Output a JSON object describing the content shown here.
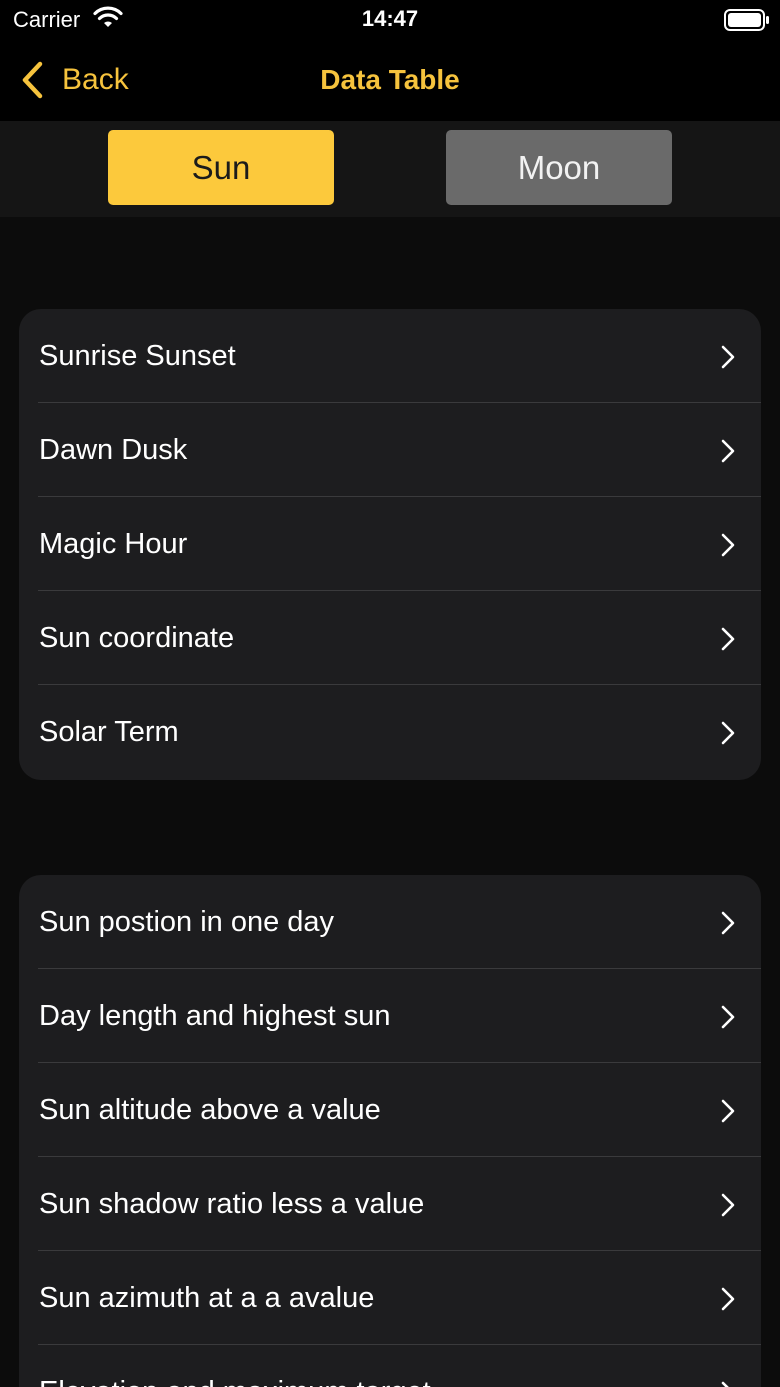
{
  "status_bar": {
    "carrier": "Carrier",
    "time": "14:47",
    "wifi_icon": "wifi-icon",
    "battery_icon": "battery-icon"
  },
  "nav": {
    "back_label": "Back",
    "title": "Data Table"
  },
  "segments": {
    "sun": "Sun",
    "moon": "Moon",
    "selected": "Sun"
  },
  "colors": {
    "accent": "#f6c33d",
    "segment_active": "#fcc93c",
    "segment_inactive": "#6a6a6a",
    "cell_background": "#1d1d1f"
  },
  "group1": {
    "items": [
      {
        "label": "Sunrise Sunset"
      },
      {
        "label": "Dawn Dusk"
      },
      {
        "label": "Magic Hour"
      },
      {
        "label": "Sun coordinate"
      },
      {
        "label": "Solar Term"
      }
    ]
  },
  "group2": {
    "items": [
      {
        "label": "Sun postion in one day"
      },
      {
        "label": "Day length and highest sun"
      },
      {
        "label": "Sun altitude above a value"
      },
      {
        "label": "Sun shadow ratio less a value"
      },
      {
        "label": "Sun azimuth at a a avalue"
      },
      {
        "label": "Elevation and maximum target"
      }
    ]
  }
}
